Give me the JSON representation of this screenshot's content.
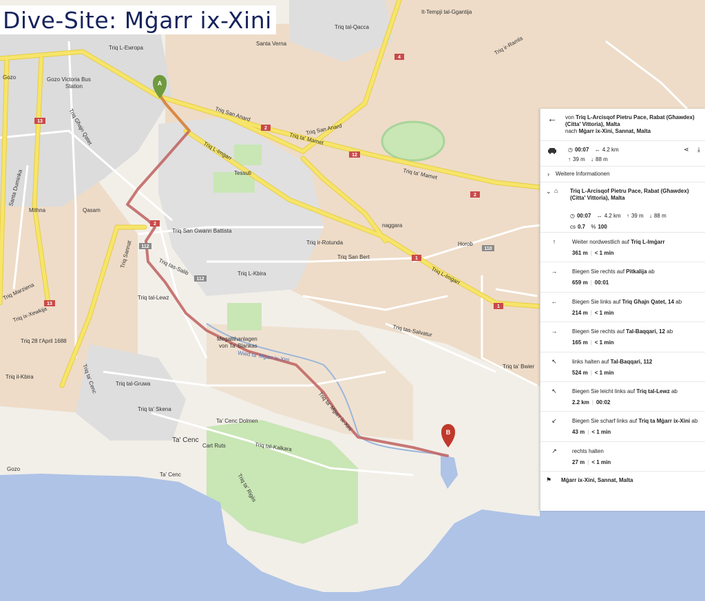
{
  "title": "Dive-Site: Mġarr ix-Xini",
  "colors": {
    "sea": "#aec3e6",
    "land": "#f2efe9",
    "urban": "#dcdcdc",
    "farmland": "#eedcc8",
    "park": "#c9e6b5",
    "major_road": "#f6e56a",
    "route": "#c0605f",
    "marker_a": "#6f9b3c",
    "marker_b": "#c0392b"
  },
  "markers": [
    {
      "label": "A",
      "name": "start"
    },
    {
      "label": "B",
      "name": "end"
    }
  ],
  "map_labels": {
    "triq_l_ewropa": "Triq L-Ewropa",
    "santa_verna": "Santa Verna",
    "it_tempji": "It-Tempji tal-Ggantija",
    "triq_san_anard_1": "Triq San Anard",
    "triq_san_anard_2": "Triq San Anard",
    "triq_ta_mamet_1": "Triq ta' Mamet",
    "triq_ta_mamet_2": "Triq ta' Mamet",
    "triq_l_imgarr_1": "Triq L-Imġarr",
    "triq_l_imgarr_2": "Triq L-Imġarr",
    "triq_ghajn_qatet": "Triq Għajn Qatet",
    "triq_sannat": "Triq Sannat",
    "santa_duminka": "Santa Duminka",
    "triq_marziena": "Triq Marziena",
    "triq_ix_xewkija": "Triq ix-Xewkija",
    "triq_28_april": "Triq 28 t'April 1688",
    "triq_il_kbira": "Triq il-Kbira",
    "triq_tal_gruwa": "Triq tal-Gruwa",
    "triq_ta_cenc": "Triq ta' Cenc",
    "triq_ta_skena": "Triq ta' Skena",
    "ta_cenc": "Ta' Cenc",
    "ta_cenc_dolmen": "Ta' Cenc Dolmen",
    "cart_ruts": "Cart Ruts",
    "megalith_1": "Megalithanlagen",
    "megalith_2": "von Ta' Blankas",
    "wied": "Wied ta' Mġarr ix-Xini",
    "triq_ta_mgarr": "Triq ta' Mġarr ix-Xini",
    "triq_tal_kalkara": "Triq tal-Kalkara",
    "triq_san_bert": "Triq San Bert",
    "triq_san_gwann": "Triq San Gwann Battista",
    "triq_ir_rotunda": "Triq ir-Rotunda",
    "triq_tas_salvatur": "Triq tas-Salvatur",
    "triq_tal_lewz": "Triq tal-Lewz",
    "triq_tas_salib": "Triq tas-Salib",
    "triq_l_kbira": "Triq L-Kbira",
    "horob": "Horob",
    "naggara": "naggara",
    "xewkija": "Xewkija",
    "gozo_victoria": "Gozo Victoria Bus",
    "station": "Station",
    "gozo_1": "Gozo",
    "gozo_2": "Gozo",
    "tessuti": "Tessuti",
    "mithna": "Mithna",
    "qasam": "Qasam",
    "ta_cenc_bottom": "Ta' Cenc",
    "triq_ta_bwier": "Triq ta' Bwier",
    "triq_ta_rigiis": "Triq ta' Rigiis",
    "triq_ir_ramla": "Triq ir-Ramla",
    "triq_tal_qacca": "Triq tal-Qacca"
  },
  "road_shields": [
    "2",
    "2",
    "12",
    "4",
    "2",
    "1",
    "1",
    "13",
    "13",
    "110",
    "112",
    "112"
  ],
  "panel": {
    "back_icon": "arrow-left-icon",
    "from_prefix": "von",
    "from_name": "Triq L-Arcisqof Pietru Pace, Rabat (Għawdex) (Citta' Vittoria), Malta",
    "to_prefix": "nach",
    "to_name": "Mġarr ix-Xini, Sannat, Malta",
    "summary": {
      "time": "00:07",
      "distance": "4.2 km",
      "ascent": "39 m",
      "descent": "88 m"
    },
    "more_label": "Weitere Informationen",
    "route": {
      "name": "Triq L-Arcisqof Pietru Pace, Rabat (Għawdex) (Citta' Vittoria), Malta",
      "time": "00:07",
      "distance": "4.2 km",
      "ascent": "39 m",
      "descent": "88 m",
      "cs": "0.7",
      "percent": "100"
    },
    "steps": [
      {
        "icon": "↑",
        "text": "Weiter nordwestlich auf",
        "street": "Triq L-Imġarr",
        "dist": "361 m",
        "time": "< 1 min"
      },
      {
        "icon": "→",
        "text": "Biegen Sie rechts auf",
        "street": "Pitkalija",
        "suffix": " ab",
        "dist": "659 m",
        "time": "00:01"
      },
      {
        "icon": "←",
        "text": "Biegen Sie links auf",
        "street": "Triq Għajn Qatet, 14",
        "suffix": " ab",
        "dist": "214 m",
        "time": "< 1 min"
      },
      {
        "icon": "→",
        "text": "Biegen Sie rechts auf",
        "street": "Tal-Baqqari, 12",
        "suffix": " ab",
        "dist": "165 m",
        "time": "< 1 min"
      },
      {
        "icon": "↖",
        "text": "links halten auf",
        "street": "Tal-Baqqari, 112",
        "dist": "524 m",
        "time": "< 1 min"
      },
      {
        "icon": "↖",
        "text": "Biegen Sie leicht links auf",
        "street": "Triq tal-Lewz",
        "suffix": " ab",
        "dist": "2.2 km",
        "time": "00:02"
      },
      {
        "icon": "↙",
        "text": "Biegen Sie scharf links auf",
        "street": "Triq ta Mġarr ix-Xini",
        "suffix": " ab",
        "dist": "43 m",
        "time": "< 1 min"
      },
      {
        "icon": "↗",
        "text": "rechts halten",
        "street": "",
        "dist": "27 m",
        "time": "< 1 min"
      }
    ],
    "destination": "Mġarr ix-Xini, Sannat, Malta"
  }
}
